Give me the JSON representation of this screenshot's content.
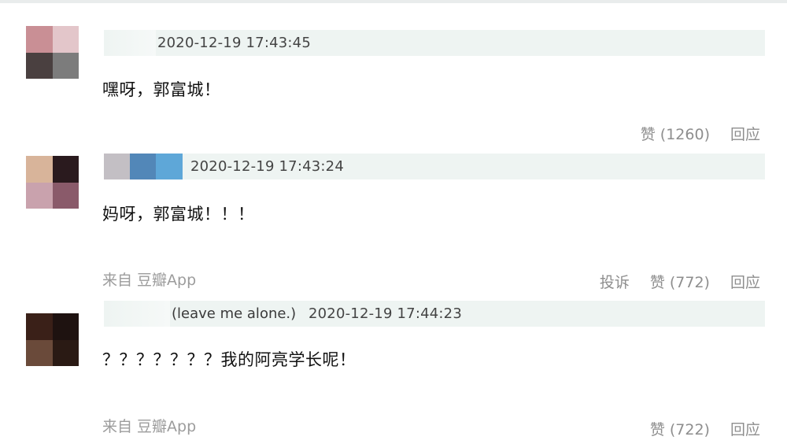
{
  "comments": [
    {
      "name": "",
      "time": "2020-12-19 17:43:45",
      "text": "嘿呀，郭富城！",
      "source": "",
      "actions": {
        "report": "",
        "like": "赞 (1260)",
        "reply": "回应"
      },
      "avatar_colors": [
        "#c98f95",
        "#e3c6ca",
        "#4a4040",
        "#7c7c7c"
      ]
    },
    {
      "name": "",
      "time": "2020-12-19 17:43:24",
      "text": "妈呀，郭富城！！！",
      "source": "来自 豆瓣App",
      "actions": {
        "report": "投诉",
        "like": "赞 (772)",
        "reply": "回应"
      },
      "avatar_colors": [
        "#d8b49a",
        "#2a1a1e",
        "#c9a2ad",
        "#8a5a6a"
      ],
      "name_colors": [
        "#c3bfc4",
        "#5287b8",
        "#5ea7d8"
      ]
    },
    {
      "name": "(leave me alone.)",
      "time": "2020-12-19 17:44:23",
      "text": "？？？？？？？我的阿亮学长呢！",
      "source": "来自 豆瓣App",
      "actions": {
        "report": "",
        "like": "赞 (722)",
        "reply": "回应"
      },
      "avatar_colors": [
        "#3a2018",
        "#1e1210",
        "#6a4a3a",
        "#2a1a14"
      ]
    }
  ]
}
